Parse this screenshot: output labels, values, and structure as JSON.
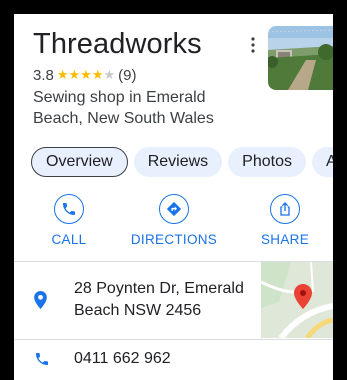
{
  "place": {
    "name": "Threadworks",
    "rating": "3.8",
    "stars_filled": 4,
    "stars_total": 5,
    "review_count": "(9)",
    "description": "Sewing shop in Emerald Beach, New South Wales"
  },
  "tabs": [
    {
      "label": "Overview",
      "active": true
    },
    {
      "label": "Reviews",
      "active": false
    },
    {
      "label": "Photos",
      "active": false
    },
    {
      "label": "A",
      "active": false
    }
  ],
  "actions": {
    "call": {
      "label": "CALL",
      "icon": "phone-icon"
    },
    "directions": {
      "label": "DIRECTIONS",
      "icon": "directions-icon"
    },
    "share": {
      "label": "SHARE",
      "icon": "share-icon"
    }
  },
  "details": {
    "address": "28 Poynten Dr, Emerald Beach NSW 2456",
    "phone": "0411 662 962"
  },
  "colors": {
    "accent": "#1a73e8",
    "star": "#fbbc04",
    "tab_bg": "#e8f0fe",
    "map_pin": "#ea4335"
  }
}
